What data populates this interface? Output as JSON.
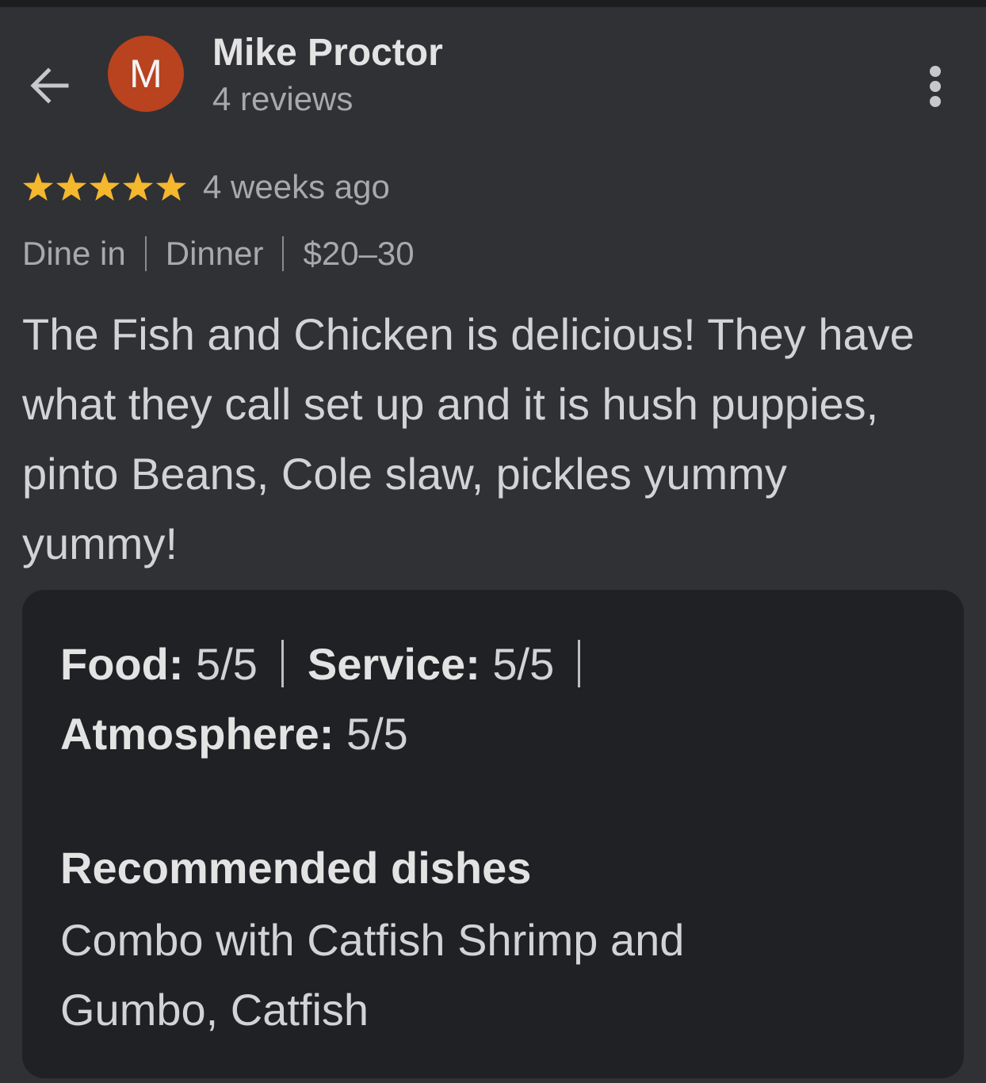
{
  "header": {
    "back_icon": "arrow-left-icon",
    "avatar_initial": "M",
    "avatar_color": "#b9421f",
    "author_name": "Mike Proctor",
    "review_count": "4 reviews",
    "more_icon": "more-vert-icon"
  },
  "review": {
    "rating": 5,
    "rating_max": 5,
    "star_color": "#f5b72e",
    "date": "4 weeks ago",
    "tags": [
      "Dine in",
      "Dinner",
      "$20–30"
    ],
    "text": "The Fish and Chicken is delicious! They have what they call set up and it is hush puppies, pinto Beans, Cole slaw, pickles yummy yummy!"
  },
  "details": {
    "scores": [
      {
        "label": "Food:",
        "value": "5/5"
      },
      {
        "label": "Service:",
        "value": "5/5"
      },
      {
        "label": "Atmosphere:",
        "value": "5/5"
      }
    ],
    "recommended_title": "Recommended dishes",
    "recommended_dishes": "Combo with Catfish Shrimp and Gumbo, Catfish"
  }
}
